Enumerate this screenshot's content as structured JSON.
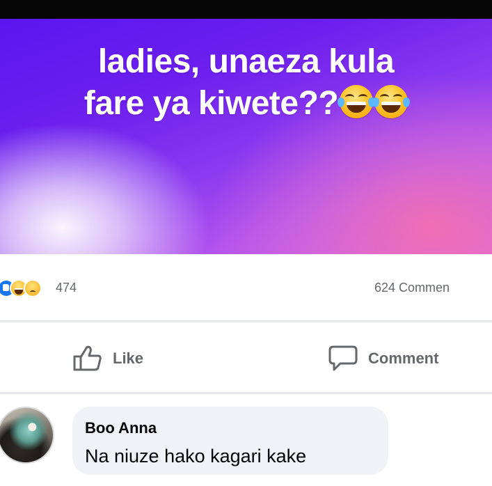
{
  "post": {
    "headline_line1": "ladies, unaeza kula",
    "headline_line2": "fare ya kiwete??",
    "headline_emojis": [
      "face-with-tears-of-joy",
      "face-with-tears-of-joy"
    ]
  },
  "stats": {
    "reaction_icons": [
      "like",
      "haha",
      "sad"
    ],
    "reaction_count": "474",
    "comment_count": "624 Commen"
  },
  "actions": {
    "like_label": "Like",
    "comment_label": "Comment"
  },
  "comment": {
    "author": "Boo Anna",
    "text": "Na niuze hako kagari kake"
  },
  "colors": {
    "top_bar": "#050505",
    "gradient_start": "#5a16ef",
    "gradient_mid": "#8b3af0",
    "gradient_end": "#f470b0",
    "like_blue": "#1877f2",
    "secondary_text": "#65676b",
    "bubble_bg": "#f0f2f5"
  }
}
